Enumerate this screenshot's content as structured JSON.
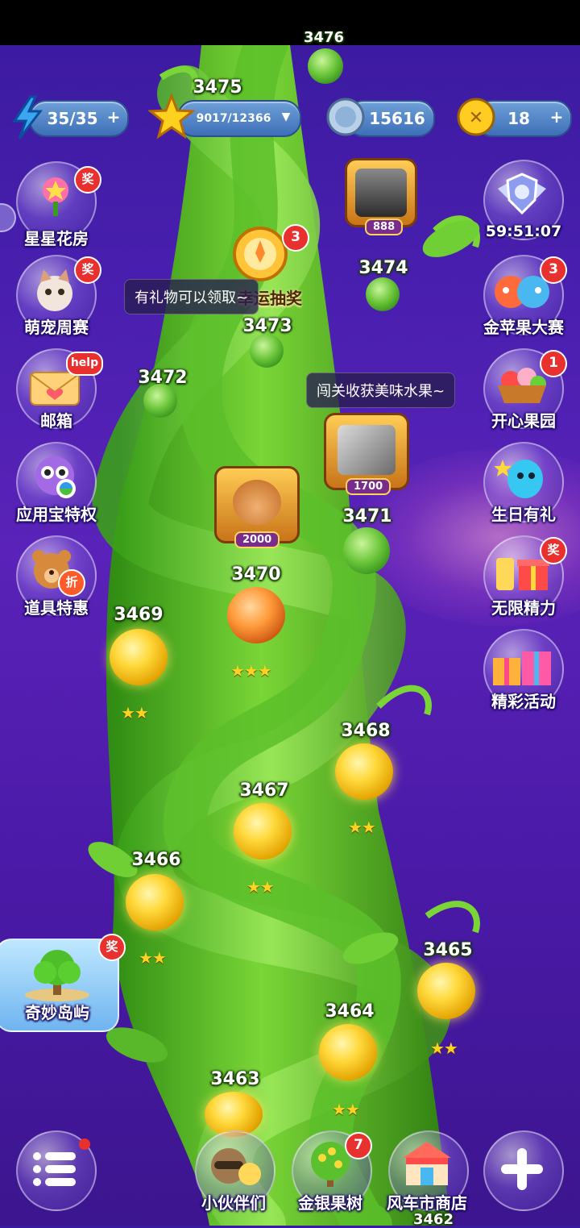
{
  "resources": {
    "energy": "35/35",
    "stars": "9017/12366",
    "coins": "15616",
    "gold_x": "18"
  },
  "timer": "59:51:07",
  "side_left": [
    {
      "label": "星星花房",
      "badge": "奖"
    },
    {
      "label": "萌宠周赛",
      "badge": "奖"
    },
    {
      "label": "邮箱",
      "badge": "help"
    },
    {
      "label": "应用宝特权"
    },
    {
      "label": "道具特惠",
      "badge": "折"
    }
  ],
  "side_right": [
    {
      "label": "金苹果大赛",
      "badge": "3"
    },
    {
      "label": "开心果园",
      "badge": "1"
    },
    {
      "label": "生日有礼"
    },
    {
      "label": "无限精力",
      "badge": "奖"
    },
    {
      "label": "精彩活动"
    }
  ],
  "lottery": {
    "label": "幸运抽奖",
    "badge": "3"
  },
  "tips": {
    "gift": "有礼物可以领取~",
    "fruit": "闯关收获美味水果~"
  },
  "avatars": {
    "friend_score": "888",
    "bear_score": "2000",
    "photo_score": "1700"
  },
  "levels": {
    "l3476": "3476",
    "l3475": "3475",
    "l3474": "3474",
    "l3473": "3473",
    "l3472": "3472",
    "l3471": "3471",
    "l3470": "3470",
    "l3469": "3469",
    "l3468": "3468",
    "l3467": "3467",
    "l3466": "3466",
    "l3465": "3465",
    "l3464": "3464",
    "l3463": "3463",
    "l3462": "3462"
  },
  "stars_marks": {
    "three": "★★★",
    "two": "★★"
  },
  "island": {
    "label": "奇妙岛屿",
    "badge": "奖"
  },
  "bottom_bar": [
    {
      "label": "小伙伴们"
    },
    {
      "label": "金银果树",
      "badge": "7"
    },
    {
      "label": "风车市商店"
    }
  ]
}
